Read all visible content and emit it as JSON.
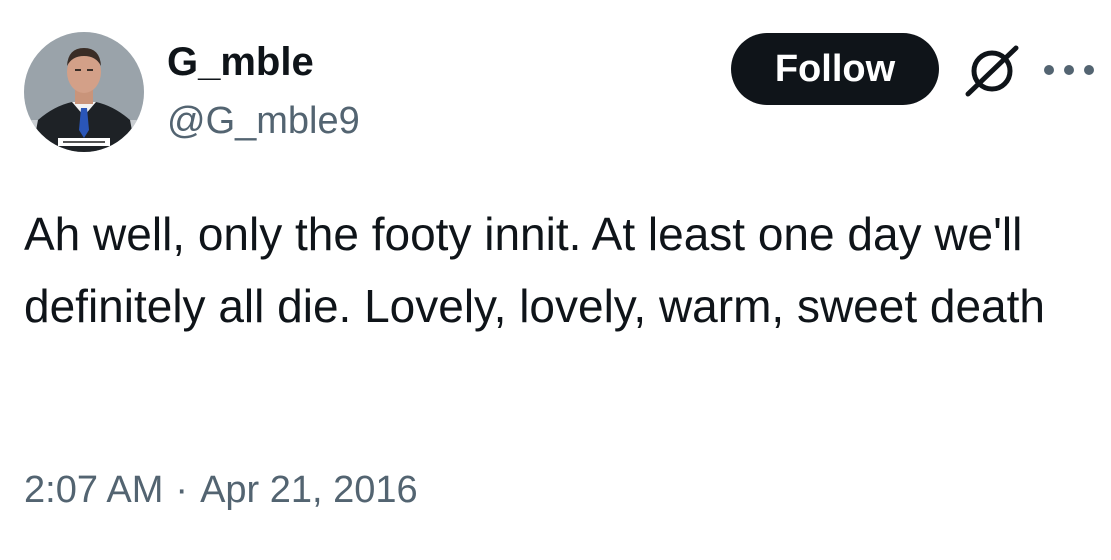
{
  "tweet": {
    "author": {
      "display_name": "G_mble",
      "handle": "@G_mble9",
      "avatar_icon": "profile-photo-man-in-suit"
    },
    "follow_label": "Follow",
    "icons": {
      "grok": "grok-icon",
      "more": "more-options-icon"
    },
    "text": "Ah well, only the footy innit. At least one day we'll definitely all die. Lovely, lovely, warm, sweet death",
    "time": "2:07 AM",
    "separator": "·",
    "date": "Apr 21, 2016"
  },
  "colors": {
    "text_primary": "#0f1419",
    "text_secondary": "#536471",
    "follow_bg": "#0f1419",
    "follow_text": "#ffffff",
    "background": "#ffffff"
  }
}
